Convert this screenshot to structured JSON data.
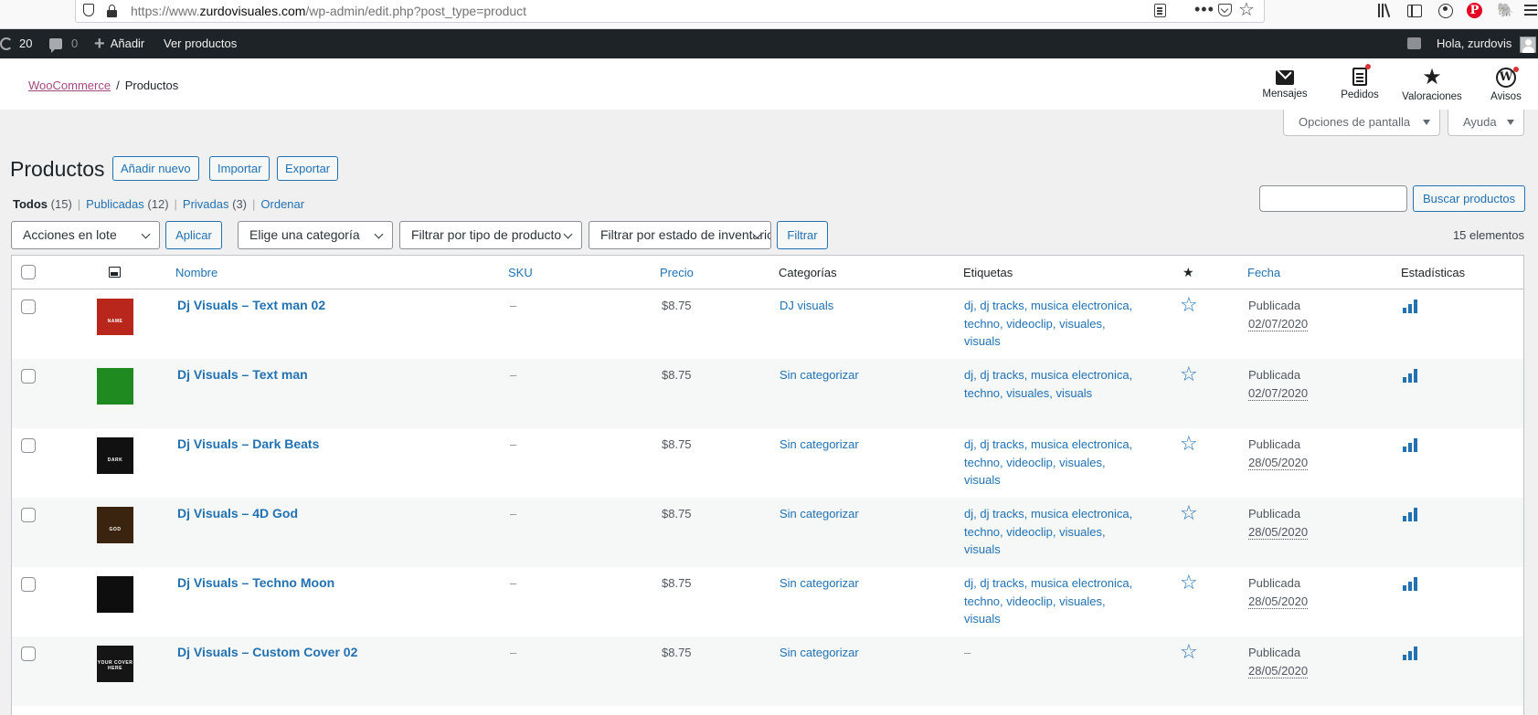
{
  "browser": {
    "url_prefix": "https://www.",
    "url_domain": "zurdovisuales.com",
    "url_path": "/wp-admin/edit.php?post_type=product"
  },
  "adminbar": {
    "updates_count": "20",
    "comments_count": "0",
    "new_label": "Añadir",
    "view_label": "Ver productos",
    "greeting": "Hola, zurdovis"
  },
  "wc_header": {
    "breadcrumb_root": "WooCommerce",
    "breadcrumb_sep": "/",
    "breadcrumb_current": "Productos",
    "actions": [
      {
        "label": "Mensajes",
        "icon": "mail-icon"
      },
      {
        "label": "Pedidos",
        "icon": "orders-icon"
      },
      {
        "label": "Valoraciones",
        "icon": "star-icon"
      },
      {
        "label": "Avisos",
        "icon": "wordpress-icon"
      }
    ]
  },
  "screen_options": {
    "screen_label": "Opciones de pantalla",
    "help_label": "Ayuda"
  },
  "page": {
    "title": "Productos",
    "add_new": "Añadir nuevo",
    "import": "Importar",
    "export": "Exportar"
  },
  "views": {
    "all_label": "Todos",
    "all_count": "(15)",
    "published_label": "Publicadas",
    "published_count": "(12)",
    "private_label": "Privadas",
    "private_count": "(3)",
    "order_label": "Ordenar"
  },
  "search": {
    "button": "Buscar productos"
  },
  "toolbar": {
    "bulk_actions": "Acciones en lote",
    "apply": "Aplicar",
    "category": "Elige una categoría",
    "product_type": "Filtrar por tipo de producto",
    "stock_status": "Filtrar por estado de inventario",
    "filter": "Filtrar",
    "item_count": "15 elementos"
  },
  "table": {
    "columns": {
      "name": "Nombre",
      "sku": "SKU",
      "price": "Precio",
      "categories": "Categorías",
      "tags": "Etiquetas",
      "date": "Fecha",
      "stats": "Estadísticas"
    },
    "rows": [
      {
        "name": "Dj Visuals – Text man 02",
        "sku": "–",
        "price": "$8.75",
        "category": "DJ visuals",
        "tags": "dj, dj tracks, musica electronica, techno, videoclip, visuales, visuals",
        "status": "Publicada",
        "date": "02/07/2020",
        "thumb_color": "#b8261c",
        "thumb_text": "NAME"
      },
      {
        "name": "Dj Visuals – Text man",
        "sku": "–",
        "price": "$8.75",
        "category": "Sin categorizar",
        "tags": "dj, dj tracks, musica electronica, techno, visuales, visuals",
        "status": "Publicada",
        "date": "02/07/2020",
        "thumb_color": "#1f8a1f",
        "thumb_text": ""
      },
      {
        "name": "Dj Visuals – Dark Beats",
        "sku": "–",
        "price": "$8.75",
        "category": "Sin categorizar",
        "tags": "dj, dj tracks, musica electronica, techno, videoclip, visuales, visuals",
        "status": "Publicada",
        "date": "28/05/2020",
        "thumb_color": "#111111",
        "thumb_text": "DARK"
      },
      {
        "name": "Dj Visuals – 4D God",
        "sku": "–",
        "price": "$8.75",
        "category": "Sin categorizar",
        "tags": "dj, dj tracks, musica electronica, techno, videoclip, visuales, visuals",
        "status": "Publicada",
        "date": "28/05/2020",
        "thumb_color": "#3a2410",
        "thumb_text": "GOD"
      },
      {
        "name": "Dj Visuals – Techno Moon",
        "sku": "–",
        "price": "$8.75",
        "category": "Sin categorizar",
        "tags": "dj, dj tracks, musica electronica, techno, videoclip, visuales, visuals",
        "status": "Publicada",
        "date": "28/05/2020",
        "thumb_color": "#0e0e0e",
        "thumb_text": ""
      },
      {
        "name": "Dj Visuals – Custom Cover 02",
        "sku": "–",
        "price": "$8.75",
        "category": "Sin categorizar",
        "tags": "–",
        "status": "Publicada",
        "date": "28/05/2020",
        "thumb_color": "#151515",
        "thumb_text": "YOUR COVER HERE"
      }
    ]
  }
}
